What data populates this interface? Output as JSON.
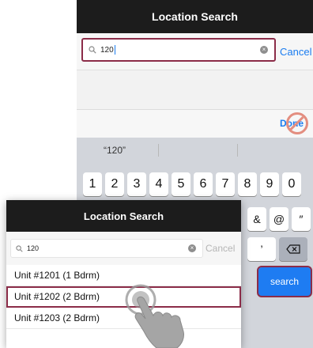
{
  "back_screen": {
    "title": "Location Search",
    "search_value": "120",
    "cancel_label": "Cancel",
    "done_label": "Done",
    "suggestion": "“120”",
    "keys_row1": [
      "1",
      "2",
      "3",
      "4",
      "5",
      "6",
      "7",
      "8",
      "9",
      "0"
    ],
    "keys_row2": [
      "&",
      "@",
      "″"
    ],
    "keys_row3": [
      "’"
    ],
    "search_key_label": "search"
  },
  "front_screen": {
    "title": "Location Search",
    "search_value": "120",
    "cancel_label": "Cancel",
    "results": [
      "Unit #1201 (1 Bdrm)",
      "Unit #1202 (2 Bdrm)",
      "Unit #1203 (2 Bdrm)"
    ]
  },
  "colors": {
    "header": "#1c1c1c",
    "accent_blue": "#1a7cf0",
    "highlight": "#8b2c48"
  }
}
